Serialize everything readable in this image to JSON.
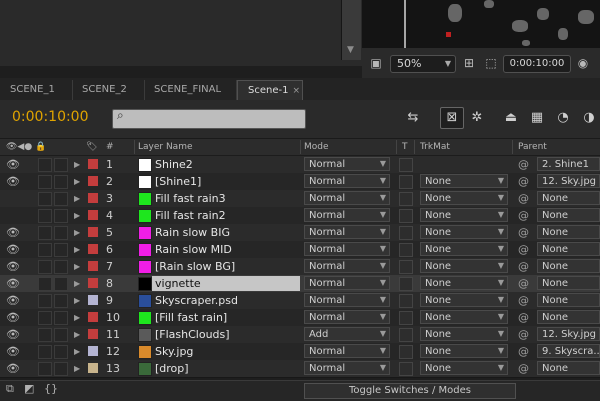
{
  "viewer": {
    "zoom": "50%",
    "timecode": "0:00:10:00"
  },
  "tabs": [
    {
      "label": "SCENE_1"
    },
    {
      "label": "SCENE_2"
    },
    {
      "label": "SCENE_FINAL"
    },
    {
      "label": "Scene-1",
      "active": true,
      "close": "×"
    }
  ],
  "toolbar": {
    "current_time": "0:00:10:00",
    "search_placeholder": ""
  },
  "columns": {
    "num": "#",
    "layer_name": "Layer Name",
    "mode": "Mode",
    "t": "T",
    "trkmat": "TrkMat",
    "parent": "Parent"
  },
  "layers": [
    {
      "num": "1",
      "name": "Shine2",
      "label_color": "#c43d3d",
      "thumb_color": "#ffffff",
      "mode": "Normal",
      "trkmat": "",
      "parent": "2. Shine1",
      "visible": true
    },
    {
      "num": "2",
      "name": "[Shine1]",
      "label_color": "#c43d3d",
      "thumb_color": "#ffffff",
      "mode": "Normal",
      "trkmat": "None",
      "parent": "12. Sky.jpg",
      "visible": true
    },
    {
      "num": "3",
      "name": "Fill fast rain3",
      "label_color": "#c43d3d",
      "thumb_color": "#1ee61e",
      "mode": "Normal",
      "trkmat": "None",
      "parent": "None",
      "visible": false
    },
    {
      "num": "4",
      "name": "Fill fast rain2",
      "label_color": "#c43d3d",
      "thumb_color": "#1ee61e",
      "mode": "Normal",
      "trkmat": "None",
      "parent": "None",
      "visible": false
    },
    {
      "num": "5",
      "name": "Rain slow BIG",
      "label_color": "#c43d3d",
      "thumb_color": "#f01ee6",
      "mode": "Normal",
      "trkmat": "None",
      "parent": "None",
      "visible": true
    },
    {
      "num": "6",
      "name": "Rain slow MID",
      "label_color": "#c43d3d",
      "thumb_color": "#f01ee6",
      "mode": "Normal",
      "trkmat": "None",
      "parent": "None",
      "visible": true
    },
    {
      "num": "7",
      "name": "[Rain slow BG]",
      "label_color": "#c43d3d",
      "thumb_color": "#f01ee6",
      "mode": "Normal",
      "trkmat": "None",
      "parent": "None",
      "visible": true
    },
    {
      "num": "8",
      "name": "vignette",
      "label_color": "#c43d3d",
      "thumb_color": "#000000",
      "mode": "Normal",
      "trkmat": "None",
      "parent": "None",
      "visible": true,
      "selected": true
    },
    {
      "num": "9",
      "name": "Skyscraper.psd",
      "label_color": "#b4b4d2",
      "thumb_color": "#2a4e9a",
      "mode": "Normal",
      "trkmat": "None",
      "parent": "None",
      "visible": true
    },
    {
      "num": "10",
      "name": "[Fill fast rain]",
      "label_color": "#c43d3d",
      "thumb_color": "#1ee61e",
      "mode": "Normal",
      "trkmat": "None",
      "parent": "None",
      "visible": true
    },
    {
      "num": "11",
      "name": "[FlashClouds]",
      "label_color": "#c43d3d",
      "thumb_color": "#5a5a5a",
      "mode": "Add",
      "trkmat": "None",
      "parent": "12. Sky.jpg",
      "visible": true
    },
    {
      "num": "12",
      "name": "Sky.jpg",
      "label_color": "#b4b4d2",
      "thumb_color": "#d98a2b",
      "mode": "Normal",
      "trkmat": "None",
      "parent": "9. Skyscra...",
      "visible": true
    },
    {
      "num": "13",
      "name": "[drop]",
      "label_color": "#c8b48c",
      "thumb_color": "#3a6a3a",
      "mode": "Normal",
      "trkmat": "None",
      "parent": "None",
      "visible": true
    }
  ],
  "bottom": {
    "toggle_label": "Toggle Switches / Modes"
  }
}
